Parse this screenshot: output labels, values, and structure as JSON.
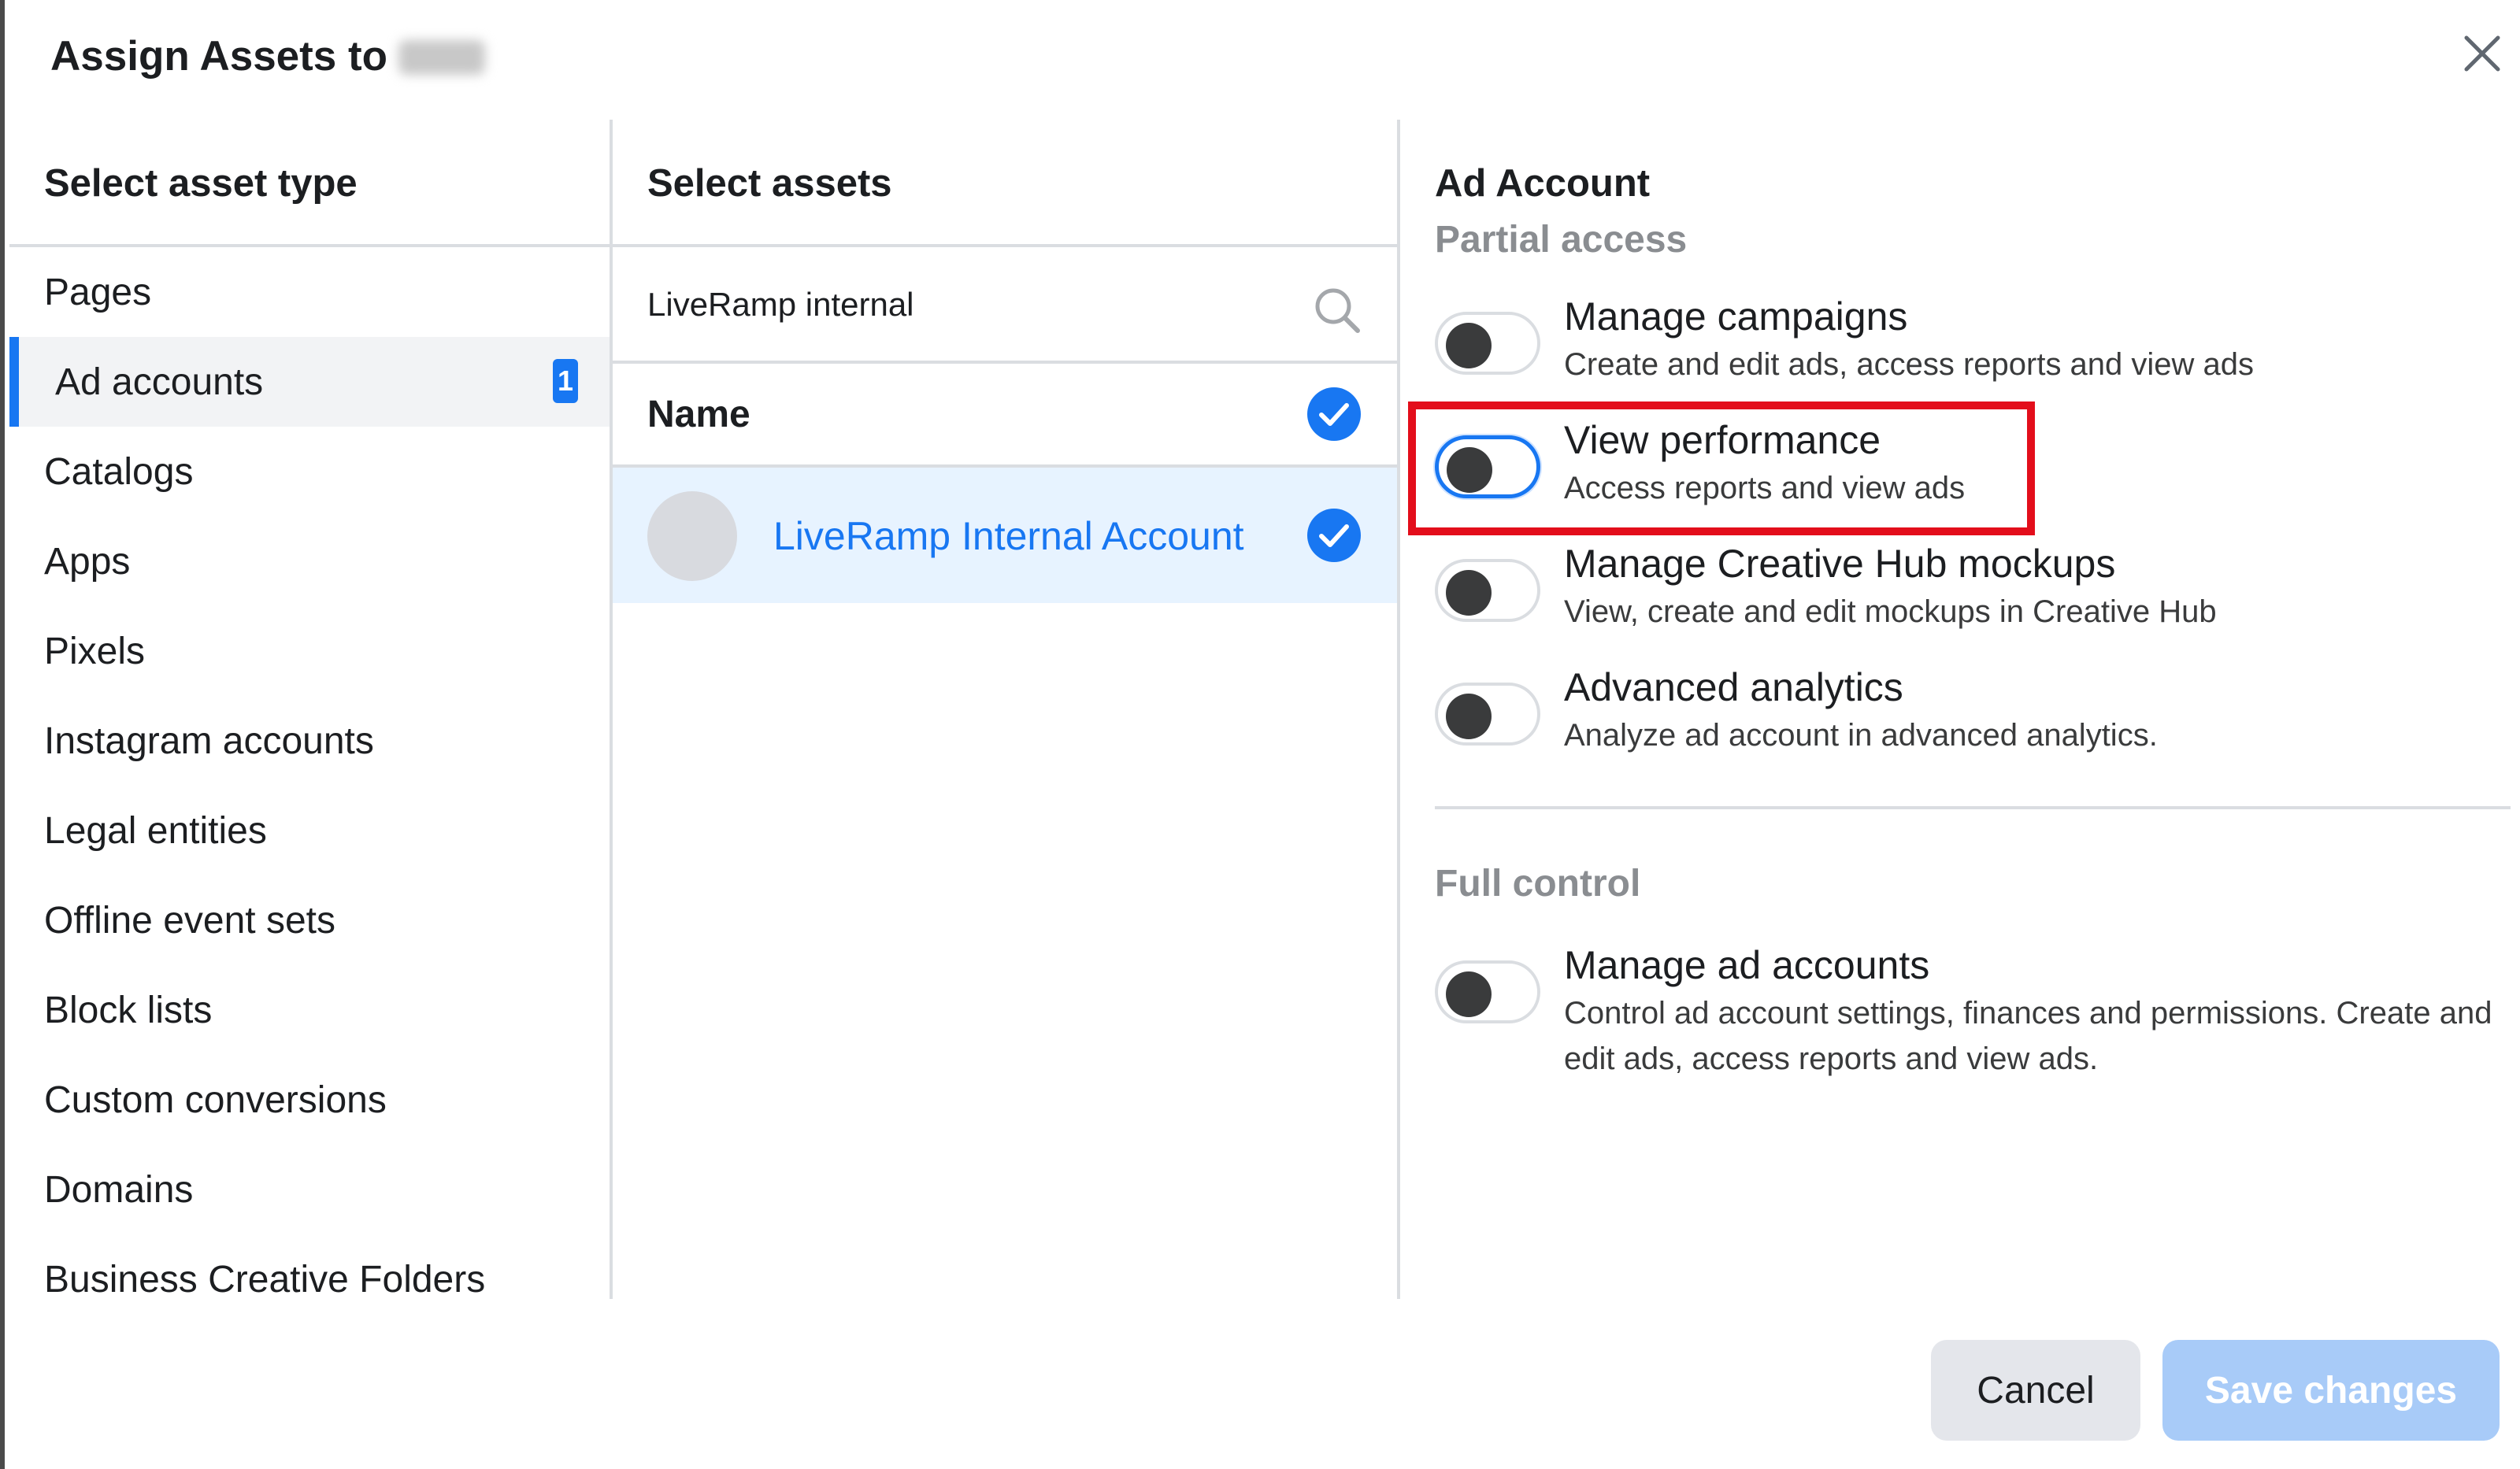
{
  "dialog": {
    "title": "Assign Assets to",
    "close_icon": "close-icon"
  },
  "asset_types": {
    "heading": "Select asset type",
    "items": [
      {
        "label": "Pages"
      },
      {
        "label": "Ad accounts",
        "selected": true,
        "count": "1"
      },
      {
        "label": "Catalogs"
      },
      {
        "label": "Apps"
      },
      {
        "label": "Pixels"
      },
      {
        "label": "Instagram accounts"
      },
      {
        "label": "Legal entities"
      },
      {
        "label": "Offline event sets"
      },
      {
        "label": "Block lists"
      },
      {
        "label": "Custom conversions"
      },
      {
        "label": "Domains"
      },
      {
        "label": "Business Creative Folders"
      }
    ]
  },
  "assets": {
    "heading": "Select assets",
    "search_value": "LiveRamp internal",
    "search_icon": "search-icon",
    "name_header": "Name",
    "rows": [
      {
        "name": "LiveRamp Internal Account",
        "checked": true
      }
    ]
  },
  "permissions": {
    "heading": "Ad Account",
    "partial_label": "Partial access",
    "partial": [
      {
        "title": "Manage campaigns",
        "description": "Create and edit ads, access reports and view ads",
        "enabled": false
      },
      {
        "title": "View performance",
        "description": "Access reports and view ads",
        "enabled": false,
        "highlighted": true
      },
      {
        "title": "Manage Creative Hub mockups",
        "description": "View, create and edit mockups in Creative Hub",
        "enabled": false
      },
      {
        "title": "Advanced analytics",
        "description": "Analyze ad account in advanced analytics.",
        "enabled": false
      }
    ],
    "full_label": "Full control",
    "full": [
      {
        "title": "Manage ad accounts",
        "description": "Control ad account settings, finances and permissions. Create and edit ads, access reports and view ads.",
        "enabled": false
      }
    ]
  },
  "footer": {
    "cancel_label": "Cancel",
    "save_label": "Save changes",
    "save_disabled": true
  },
  "colors": {
    "accent": "#1877f2",
    "highlight_border": "#e30e1b",
    "disabled_button": "#a8cbf8"
  }
}
